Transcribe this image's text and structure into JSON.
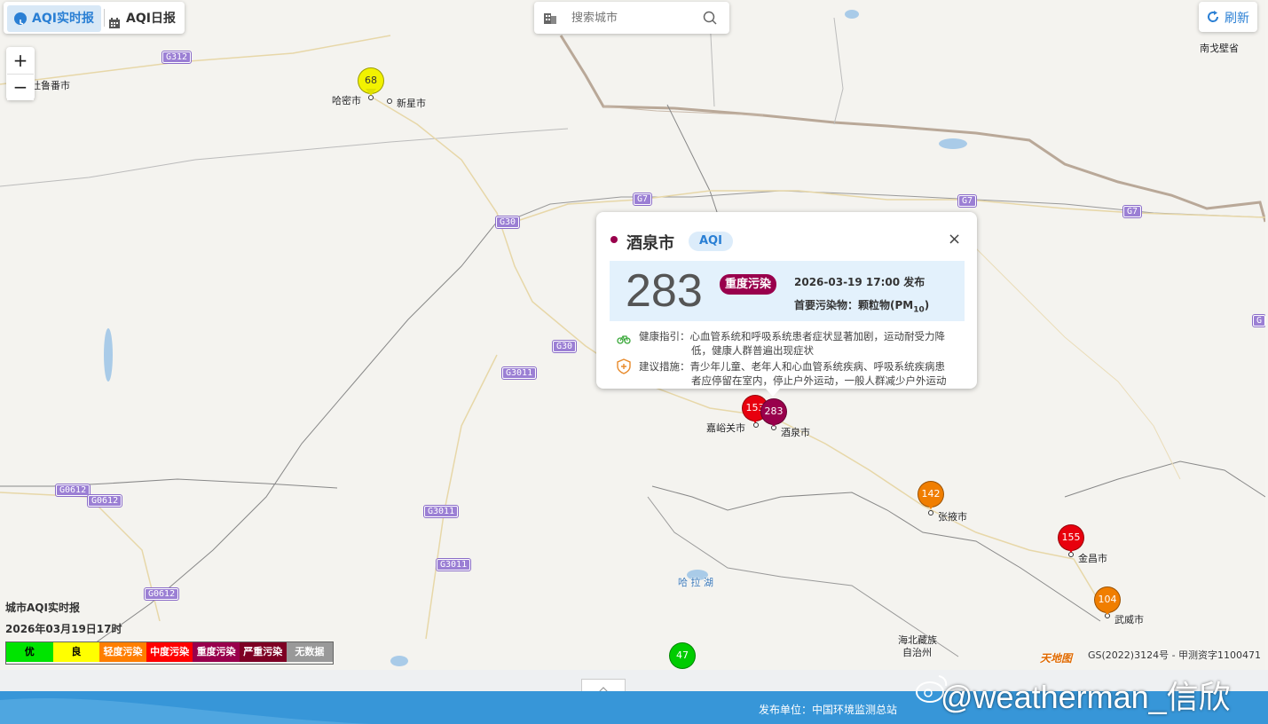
{
  "tabs": [
    {
      "label": "AQI实时报",
      "icon": "clock-icon",
      "active": true
    },
    {
      "label": "AQI日报",
      "icon": "calendar-icon",
      "active": false
    }
  ],
  "search": {
    "placeholder": "搜索城市"
  },
  "refresh_label": "刷新",
  "zoom": {
    "in": "+",
    "out": "−"
  },
  "region_labels": {
    "gobi": "南戈壁省",
    "lake": "哈 拉 湖",
    "haibei_1": "海北藏族",
    "haibei_2": "自治州",
    "turpan": "吐鲁番市"
  },
  "roads": [
    "G312",
    "G7",
    "G7",
    "G7",
    "G30",
    "G30",
    "G3011",
    "G3011",
    "G3011",
    "G0612",
    "G0612",
    "G0612",
    "G"
  ],
  "cities": [
    {
      "name": "哈密市",
      "aqi": "68",
      "color": "#f2f200"
    },
    {
      "name": "新星市"
    },
    {
      "name": "嘉峪关市",
      "aqi": "153",
      "color": "#e8000e"
    },
    {
      "name": "酒泉市",
      "aqi": "283",
      "color": "#99004c"
    },
    {
      "name": "张掖市",
      "aqi": "142",
      "color": "#f07e00"
    },
    {
      "name": "金昌市",
      "aqi": "155",
      "color": "#e8000e"
    },
    {
      "name": "武威市",
      "aqi": "104",
      "color": "#f07e00"
    },
    {
      "name": "",
      "aqi": "47",
      "color": "#00cc00"
    }
  ],
  "popup": {
    "city": "酒泉市",
    "tag": "AQI",
    "close": "×",
    "aqi": "283",
    "level": "重度污染",
    "time": "2026-03-19 17:00 发布",
    "pollutant_prefix": "首要污染物：颗粒物(PM",
    "pollutant_sub": "10",
    "pollutant_suffix": ")",
    "health_label": "健康指引：",
    "health_1": "心血管系统和呼吸系统患者症状显著加剧，运动耐受力降",
    "health_2": "低，健康人群普遍出现症状",
    "advice_label": "建议措施：",
    "advice_1": "青少年儿童、老年人和心血管系统疾病、呼吸系统疾病患",
    "advice_2": "者应停留在室内，停止户外运动，一般人群减少户外运动"
  },
  "legend": {
    "title": "城市AQI实时报",
    "date": "2026年03月19日17时",
    "items": [
      {
        "label": "优",
        "color": "#00e400",
        "text": "#000"
      },
      {
        "label": "良",
        "color": "#ffff00",
        "text": "#000"
      },
      {
        "label": "轻度污染",
        "color": "#ff7e00",
        "text": "#fff"
      },
      {
        "label": "中度污染",
        "color": "#ff0000",
        "text": "#fff"
      },
      {
        "label": "重度污染",
        "color": "#99004c",
        "text": "#fff"
      },
      {
        "label": "严重污染",
        "color": "#7e0023",
        "text": "#fff"
      },
      {
        "label": "无数据",
        "color": "#999999",
        "text": "#fff"
      }
    ]
  },
  "map_credit": "GS(2022)3124号 - 甲测资字1100471",
  "map_logo": "天地图",
  "footer": {
    "publisher": "发布单位：中国环境监测总站",
    "watermark": "@weatherman_信欣"
  }
}
